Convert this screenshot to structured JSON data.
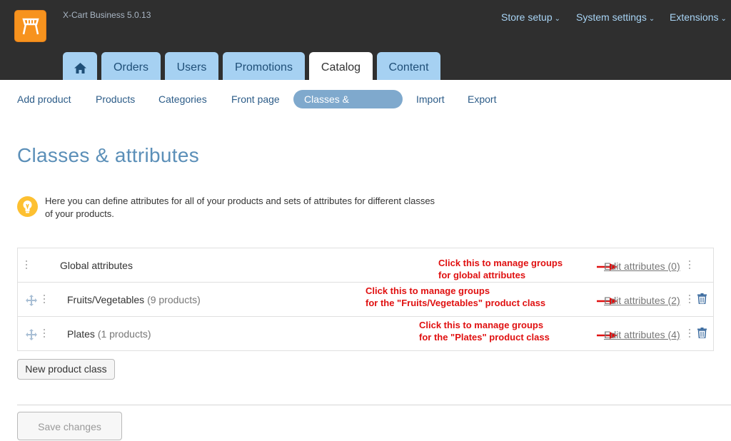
{
  "app": {
    "version": "X-Cart Business 5.0.13"
  },
  "top_menu": [
    {
      "label": "Store setup"
    },
    {
      "label": "System settings"
    },
    {
      "label": "Extensions"
    }
  ],
  "tabs": [
    {
      "label": "Orders"
    },
    {
      "label": "Users"
    },
    {
      "label": "Promotions"
    },
    {
      "label": "Catalog",
      "active": true
    },
    {
      "label": "Content"
    }
  ],
  "subnav": [
    {
      "label": "Add product"
    },
    {
      "label": "Products"
    },
    {
      "label": "Categories"
    },
    {
      "label": "Front page"
    },
    {
      "label": "Classes & attributes",
      "active": true
    },
    {
      "label": "Import"
    },
    {
      "label": "Export"
    }
  ],
  "page": {
    "title": "Classes & attributes",
    "info": "Here you can define attributes for all of your products and sets of attributes for different classes of your products."
  },
  "rows": [
    {
      "name": "Global attributes",
      "count": "",
      "edit": "Edit attributes (0)",
      "annotation": [
        "Click this to manage groups",
        "for global attributes"
      ]
    },
    {
      "name": "Fruits/Vegetables",
      "count": "(9 products)",
      "edit": "Edit attributes (2)",
      "annotation": [
        "Click this to manage groups",
        "for the \"Fruits/Vegetables\" product class"
      ]
    },
    {
      "name": "Plates",
      "count": "(1 products)",
      "edit": "Edit attributes (4)",
      "annotation": [
        "Click this to manage groups",
        "for the \"Plates\" product class"
      ]
    }
  ],
  "buttons": {
    "new_class": "New product class",
    "save": "Save changes"
  },
  "colors": {
    "header_bg": "#2f2f2f",
    "tab_bg": "#a6d1f2",
    "accent": "#5b8fb8",
    "annotation": "#e01010",
    "logo": "#f7931e"
  }
}
